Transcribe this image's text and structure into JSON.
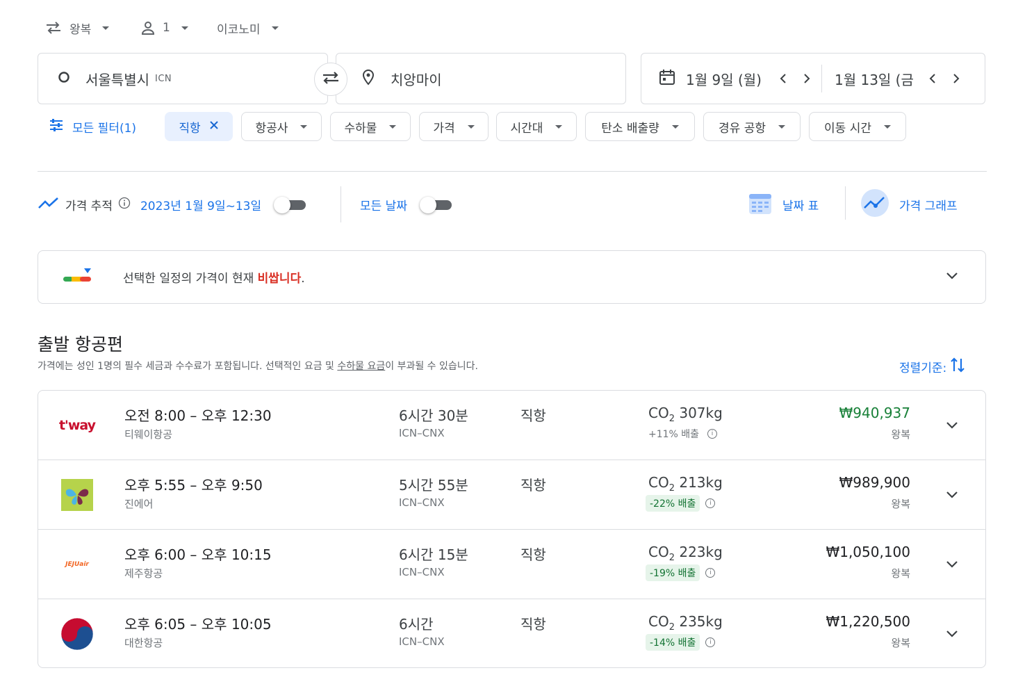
{
  "top_options": {
    "trip_type": "왕복",
    "passengers": "1",
    "cabin": "이코노미"
  },
  "search": {
    "origin": "서울특별시",
    "origin_code": "ICN",
    "destination": "치앙마이",
    "depart_date": "1월 9일 (월)",
    "return_date": "1월 13일 (금"
  },
  "filters": {
    "all_filters": "모든 필터(1)",
    "active_chip": "직항",
    "chips": [
      "항공사",
      "수하물",
      "가격",
      "시간대",
      "탄소 배출량",
      "경유 공항",
      "이동 시간"
    ]
  },
  "tracking": {
    "label": "가격 추적",
    "date_range": "2023년 1월 9일~13일",
    "any_dates": "모든 날짜",
    "date_grid": "날짜 표",
    "price_graph": "가격 그래프"
  },
  "insight": {
    "text_before": "선택한 일정의 가격이 현재 ",
    "highlight": "비쌉니다",
    "text_after": "."
  },
  "section": {
    "title": "출발 항공편",
    "subtitle_before": "가격에는 성인 1명의 필수 세금과 수수료가 포함됩니다. 선택적인 요금 및 ",
    "subtitle_link": "수하물 요금",
    "subtitle_after": "이 부과될 수 있습니다.",
    "sort_label": "정렬기준:"
  },
  "flights": [
    {
      "times": "오전 8:00 – 오후 12:30",
      "airline": "티웨이항공",
      "logo": "t'way",
      "duration": "6시간 30분",
      "route": "ICN–CNX",
      "stops": "직항",
      "co2_value": "307kg",
      "emissions": "+11% 배출",
      "price": "₩940,937",
      "price_type": "왕복"
    },
    {
      "times": "오후 5:55 – 오후 9:50",
      "airline": "진에어",
      "logo": "jinair-butterfly",
      "duration": "5시간 55분",
      "route": "ICN–CNX",
      "stops": "직항",
      "co2_value": "213kg",
      "emissions": "-22% 배출",
      "price": "₩989,900",
      "price_type": "왕복"
    },
    {
      "times": "오후 6:00 – 오후 10:15",
      "airline": "제주항공",
      "logo": "JEJUair",
      "duration": "6시간 15분",
      "route": "ICN–CNX",
      "stops": "직항",
      "co2_value": "223kg",
      "emissions": "-19% 배출",
      "price": "₩1,050,100",
      "price_type": "왕복"
    },
    {
      "times": "오후 6:05 – 오후 10:05",
      "airline": "대한항공",
      "logo": "koreanair-taegeuk",
      "duration": "6시간",
      "route": "ICN–CNX",
      "stops": "직항",
      "co2_value": "235kg",
      "emissions": "-14% 배출",
      "price": "₩1,220,500",
      "price_type": "왕복"
    }
  ],
  "colors": {
    "accent": "#1a73e8",
    "price_good": "#188038",
    "warning": "#d93025",
    "emission_low_bg": "#e6f4ea"
  }
}
